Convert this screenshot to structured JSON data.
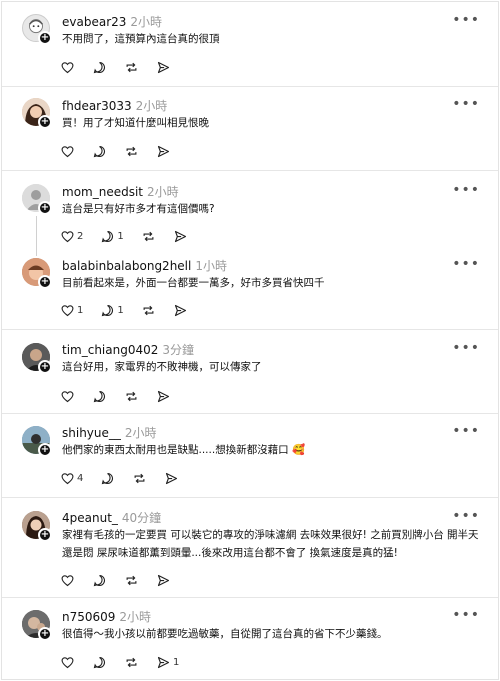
{
  "posts": [
    {
      "user": "evabear23",
      "time": "2小時",
      "text": "不用問了，這預算內這台真的很頂",
      "likes": "",
      "replies": "",
      "reposts": "",
      "shares": "",
      "avatar": "#c9c9c9"
    },
    {
      "user": "fhdear3033",
      "time": "2小時",
      "text": "買！用了才知道什麼叫相見恨晚",
      "likes": "",
      "replies": "",
      "reposts": "",
      "shares": "",
      "avatar": "#b98a6d"
    },
    {
      "user": "mom_needsit",
      "time": "2小時",
      "text": "這台是只有好市多才有這個價嗎?",
      "likes": "2",
      "replies": "1",
      "reposts": "",
      "shares": "",
      "avatar": "#bdbdbd"
    },
    {
      "user": "balabinbalabong2hell",
      "time": "1小時",
      "text": "目前看起來是，外面一台都要一萬多，好市多買省快四千",
      "likes": "1",
      "replies": "1",
      "reposts": "",
      "shares": "",
      "avatar": "#a66b55"
    },
    {
      "user": "tim_chiang0402",
      "time": "3分鐘",
      "text": "這台好用，家電界的不敗神機，可以傳家了",
      "likes": "",
      "replies": "",
      "reposts": "",
      "shares": "",
      "avatar": "#3c3c3c"
    },
    {
      "user": "shihyue__",
      "time": "2小時",
      "text": "他們家的東西太耐用也是缺點.....想換新都沒藉口 🥰",
      "likes": "4",
      "replies": "",
      "reposts": "",
      "shares": "",
      "avatar": "#4c6f8a"
    },
    {
      "user": "4peanut_",
      "time": "40分鐘",
      "text": "家裡有毛孩的一定要買 可以裝它的專攻的淨味濾網 去味效果很好! 之前買別牌小台 開半天還是悶 屎尿味道都薰到頭暈...後來改用這台都不會了 換氣速度是真的猛!",
      "likes": "",
      "replies": "",
      "reposts": "",
      "shares": "",
      "avatar": "#7a5b4c"
    },
    {
      "user": "n750609",
      "time": "2小時",
      "text": "很值得～我小孩以前都要吃過敏藥，自從開了這台真的省下不少藥錢。",
      "likes": "",
      "replies": "",
      "reposts": "",
      "shares": "1",
      "avatar": "#555555"
    }
  ],
  "icons": {
    "like": "heart-icon",
    "reply": "comment-icon",
    "repost": "repost-icon",
    "share": "share-icon",
    "more": "more-icon",
    "follow": "plus-icon"
  },
  "more_label": "•••",
  "follow_label": "+"
}
